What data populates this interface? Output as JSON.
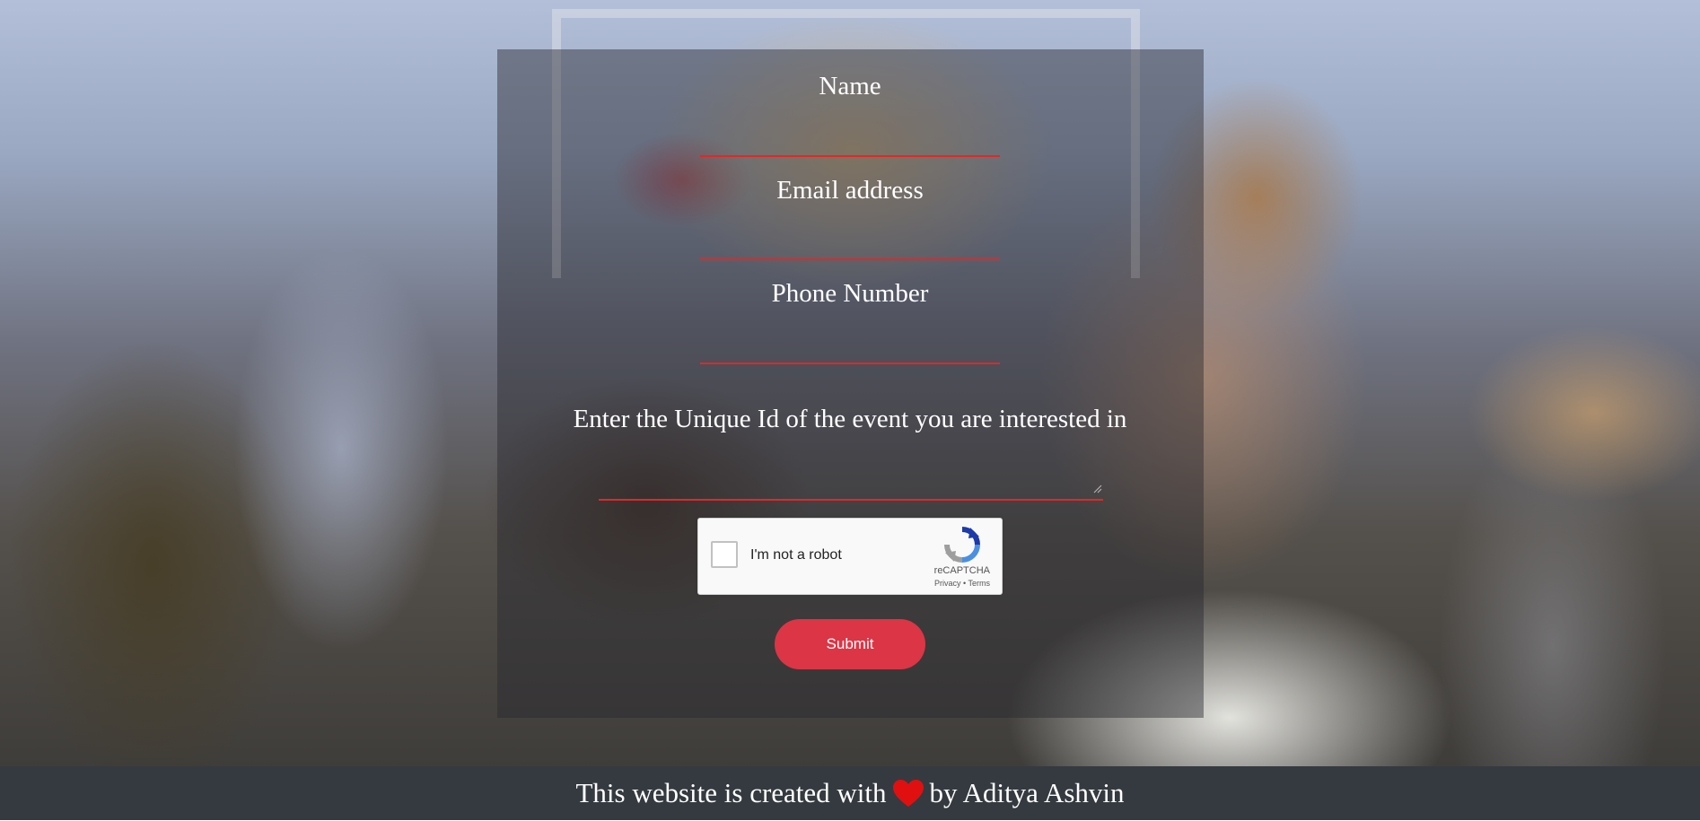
{
  "form": {
    "name_label": "Name",
    "email_label": "Email address",
    "phone_label": "Phone Number",
    "event_id_label": "Enter the Unique Id of the event you are interested in"
  },
  "captcha": {
    "label": "I'm not a robot",
    "brand": "reCAPTCHA",
    "links": "Privacy • Terms"
  },
  "submit_label": "Submit",
  "footer": {
    "prefix": "This website is created with",
    "suffix": "by Aditya Ashvin"
  },
  "colors": {
    "underline": "#e02828",
    "submit": "#dc3545",
    "footer": "#343a40",
    "heart": "#e01010"
  },
  "icons": [
    "heart-icon",
    "recaptcha-logo-icon",
    "resize-grip-icon"
  ]
}
